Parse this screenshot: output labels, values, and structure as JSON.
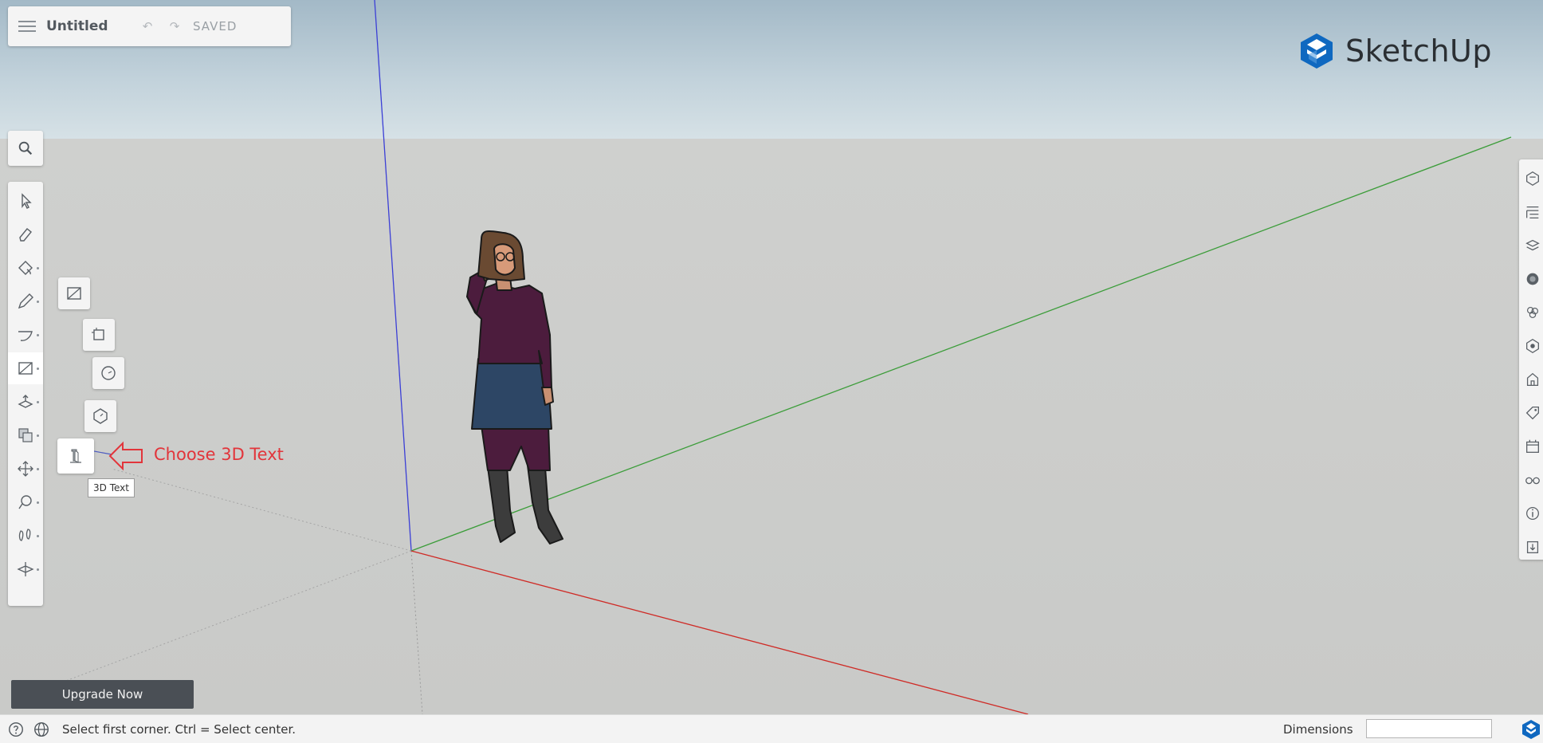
{
  "app": {
    "brand_name": "SketchUp",
    "brand_icon": "sketchup-logo-icon",
    "brand_color": "#0f68c0"
  },
  "document": {
    "title": "Untitled",
    "status": "SAVED",
    "menu_icon": "hamburger-menu-icon",
    "undo_icon": "undo-icon",
    "redo_icon": "redo-icon"
  },
  "left_toolbar": {
    "search_icon": "search-icon",
    "tools": [
      {
        "name": "select",
        "icon": "select-arrow-icon"
      },
      {
        "name": "eraser",
        "icon": "eraser-icon"
      },
      {
        "name": "paint",
        "icon": "paint-bucket-icon"
      },
      {
        "name": "line",
        "icon": "pencil-icon"
      },
      {
        "name": "arc",
        "icon": "arc-icon"
      },
      {
        "name": "shapes",
        "icon": "rectangle-icon",
        "active": true
      },
      {
        "name": "push-pull",
        "icon": "push-pull-icon"
      },
      {
        "name": "move",
        "icon": "move-copy-icon"
      },
      {
        "name": "orbit",
        "icon": "orbit-icon"
      },
      {
        "name": "tape",
        "icon": "tape-measure-icon"
      },
      {
        "name": "walk",
        "icon": "footprints-icon"
      },
      {
        "name": "section",
        "icon": "section-plane-icon"
      }
    ]
  },
  "flyout": {
    "items": [
      {
        "icon": "rectangle-icon"
      },
      {
        "icon": "rotated-rectangle-icon"
      },
      {
        "icon": "circle-icon"
      },
      {
        "icon": "polygon-icon"
      },
      {
        "icon": "3d-text-icon",
        "active": true
      }
    ],
    "tooltip": "3D Text"
  },
  "annotation": {
    "text": "Choose 3D Text",
    "color": "#e2353b",
    "icon": "left-arrow-outline-icon"
  },
  "right_toolbar": {
    "icons": [
      "entity-info-icon",
      "outliner-icon",
      "components-icon",
      "materials-icon",
      "styles-icon",
      "scenes-icon",
      "instructor-icon",
      "tags-icon",
      "display-icon",
      "views-icon",
      "info-icon",
      "export-icon"
    ]
  },
  "upgrade": {
    "label": "Upgrade Now"
  },
  "statusbar": {
    "help_icon": "help-circle-icon",
    "globe_icon": "globe-icon",
    "message": "Select first corner. Ctrl = Select center.",
    "dimensions_label": "Dimensions",
    "dimensions_value": ""
  },
  "axes": {
    "blue": "#3b3fd6",
    "green": "#3c9d3a",
    "red": "#cf2b26"
  }
}
